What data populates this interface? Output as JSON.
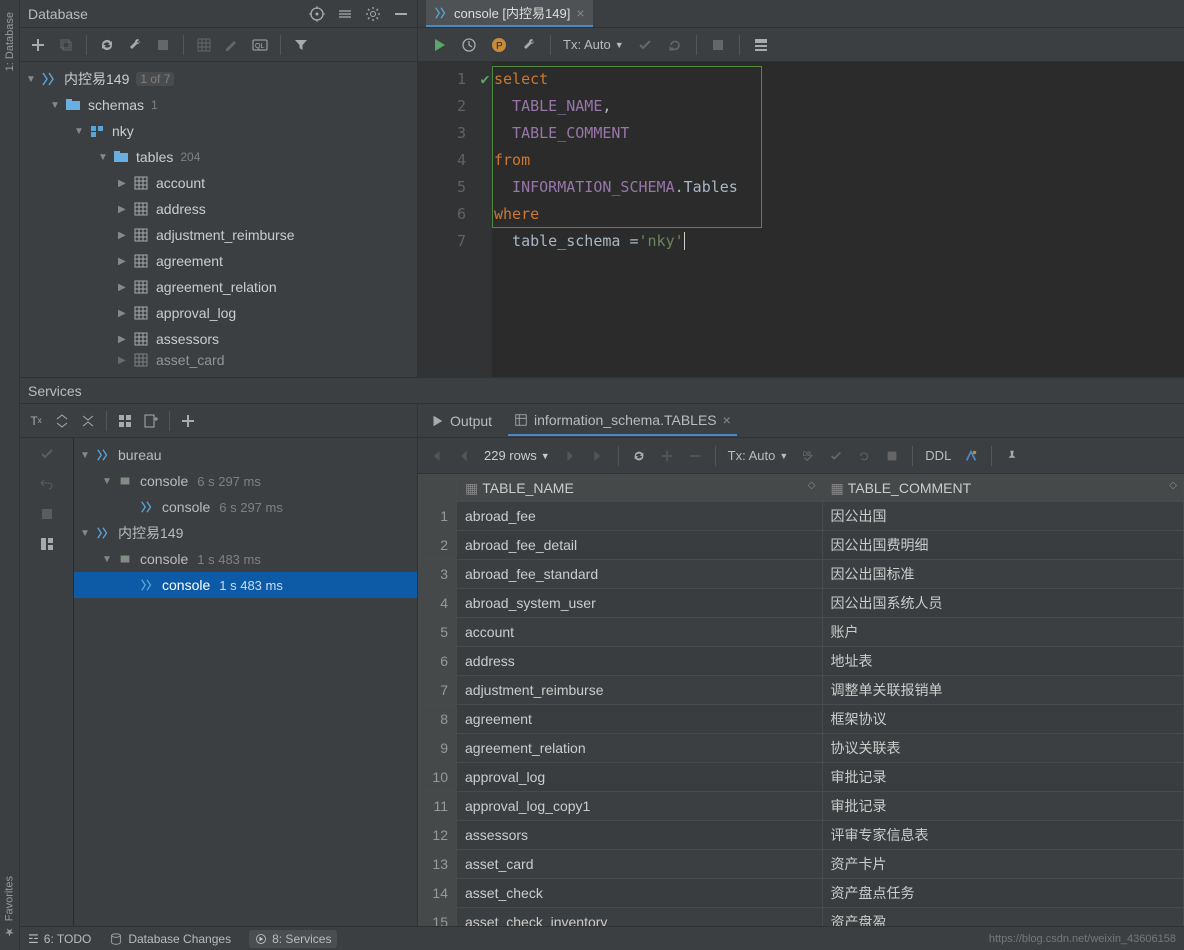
{
  "database_panel": {
    "title": "Database",
    "connection": {
      "name": "内控易149",
      "counter": "1 of 7"
    },
    "schemas_label": "schemas",
    "schemas_count": "1",
    "schema_name": "nky",
    "tables_label": "tables",
    "tables_count": "204",
    "tables": [
      "account",
      "address",
      "adjustment_reimburse",
      "agreement",
      "agreement_relation",
      "approval_log",
      "assessors",
      "asset_card"
    ]
  },
  "editor": {
    "tab_label": "console [内控易149]",
    "tx_label": "Tx: Auto",
    "lines": [
      "1",
      "2",
      "3",
      "4",
      "5",
      "6",
      "7"
    ],
    "code": {
      "l1": "select",
      "l2a": "  TABLE_NAME",
      "l2b": ",",
      "l3": "  TABLE_COMMENT",
      "l4": "from",
      "l5a": "  INFORMATION_SCHEMA",
      "l5b": ".Tables",
      "l6": "where",
      "l7a": "  table_schema ",
      "l7b": "=",
      "l7c": "'nky'"
    }
  },
  "services": {
    "title": "Services",
    "tree": [
      {
        "name": "bureau",
        "indent": 0,
        "kind": "ds",
        "arrow": "▼"
      },
      {
        "name": "console",
        "time": "6 s 297 ms",
        "indent": 1,
        "kind": "grp",
        "arrow": "▼"
      },
      {
        "name": "console",
        "time": "6 s 297 ms",
        "indent": 2,
        "kind": "leaf",
        "arrow": ""
      },
      {
        "name": "内控易149",
        "indent": 0,
        "kind": "ds",
        "arrow": "▼"
      },
      {
        "name": "console",
        "time": "1 s 483 ms",
        "indent": 1,
        "kind": "grp",
        "arrow": "▼"
      },
      {
        "name": "console",
        "time": "1 s 483 ms",
        "indent": 2,
        "kind": "leaf",
        "arrow": "",
        "selected": true
      }
    ],
    "output_tab": "Output",
    "result_tab": "information_schema.TABLES",
    "rows_info": "229 rows",
    "tx_label": "Tx: Auto",
    "ddl_label": "DDL",
    "columns": [
      "TABLE_NAME",
      "TABLE_COMMENT"
    ],
    "rows": [
      {
        "n": "1",
        "name": "abroad_fee",
        "comment": "因公出国"
      },
      {
        "n": "2",
        "name": "abroad_fee_detail",
        "comment": "因公出国费明细"
      },
      {
        "n": "3",
        "name": "abroad_fee_standard",
        "comment": "因公出国标准"
      },
      {
        "n": "4",
        "name": "abroad_system_user",
        "comment": "因公出国系统人员"
      },
      {
        "n": "5",
        "name": "account",
        "comment": "账户"
      },
      {
        "n": "6",
        "name": "address",
        "comment": "地址表"
      },
      {
        "n": "7",
        "name": "adjustment_reimburse",
        "comment": "调整单关联报销单"
      },
      {
        "n": "8",
        "name": "agreement",
        "comment": "框架协议"
      },
      {
        "n": "9",
        "name": "agreement_relation",
        "comment": "协议关联表"
      },
      {
        "n": "10",
        "name": "approval_log",
        "comment": "审批记录"
      },
      {
        "n": "11",
        "name": "approval_log_copy1",
        "comment": "审批记录"
      },
      {
        "n": "12",
        "name": "assessors",
        "comment": "评审专家信息表"
      },
      {
        "n": "13",
        "name": "asset_card",
        "comment": "资产卡片"
      },
      {
        "n": "14",
        "name": "asset_check",
        "comment": "资产盘点任务"
      },
      {
        "n": "15",
        "name": "asset_check_inventory",
        "comment": "资产盘盈"
      }
    ]
  },
  "bottom": {
    "todo": "6: TODO",
    "dbchanges": "Database Changes",
    "services": "8: Services",
    "watermark": "https://blog.csdn.net/weixin_43606158"
  },
  "left_gutter": {
    "top": "1: Database",
    "bottom": "Favorites"
  }
}
